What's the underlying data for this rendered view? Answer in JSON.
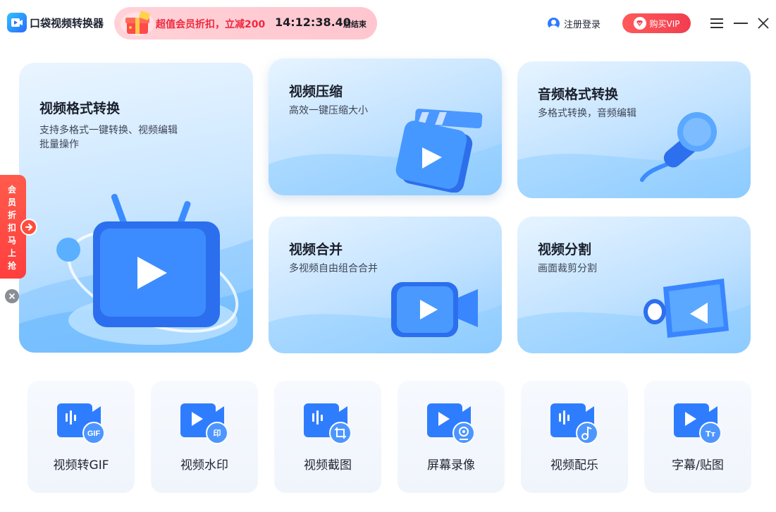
{
  "header": {
    "app_title": "口袋视频转换器",
    "promo_text": "超值会员折扣，立减200",
    "promo_time": "14:12:38.40",
    "promo_suffix": "后结束",
    "login_label": "注册登录",
    "vip_label": "购买VIP"
  },
  "cards": {
    "main": {
      "title": "视频格式转换",
      "subtitle_line1": "支持多格式一键转换、视频编辑",
      "subtitle_line2": "批量操作"
    },
    "compress": {
      "title": "视频压缩",
      "subtitle": "高效一键压缩大小"
    },
    "audio": {
      "title": "音频格式转换",
      "subtitle": "多格式转换，音频编辑"
    },
    "merge": {
      "title": "视频合并",
      "subtitle": "多视频自由组合合并"
    },
    "split": {
      "title": "视频分割",
      "subtitle": "画面裁剪分割"
    }
  },
  "side_promo": {
    "text": "会员折扣马上抢"
  },
  "tools": [
    {
      "label": "视频转GIF",
      "badge": "GIF"
    },
    {
      "label": "视频水印",
      "badge": "印"
    },
    {
      "label": "视频截图",
      "badge": "crop-icon"
    },
    {
      "label": "屏幕录像",
      "badge": "webcam-icon"
    },
    {
      "label": "视频配乐",
      "badge": "music-note-icon"
    },
    {
      "label": "字幕/贴图",
      "badge": "Tт"
    }
  ],
  "colors": {
    "accent_blue": "#2f7bff",
    "promo_red": "#ef2a3f",
    "vip_red": "#f23d4f"
  }
}
